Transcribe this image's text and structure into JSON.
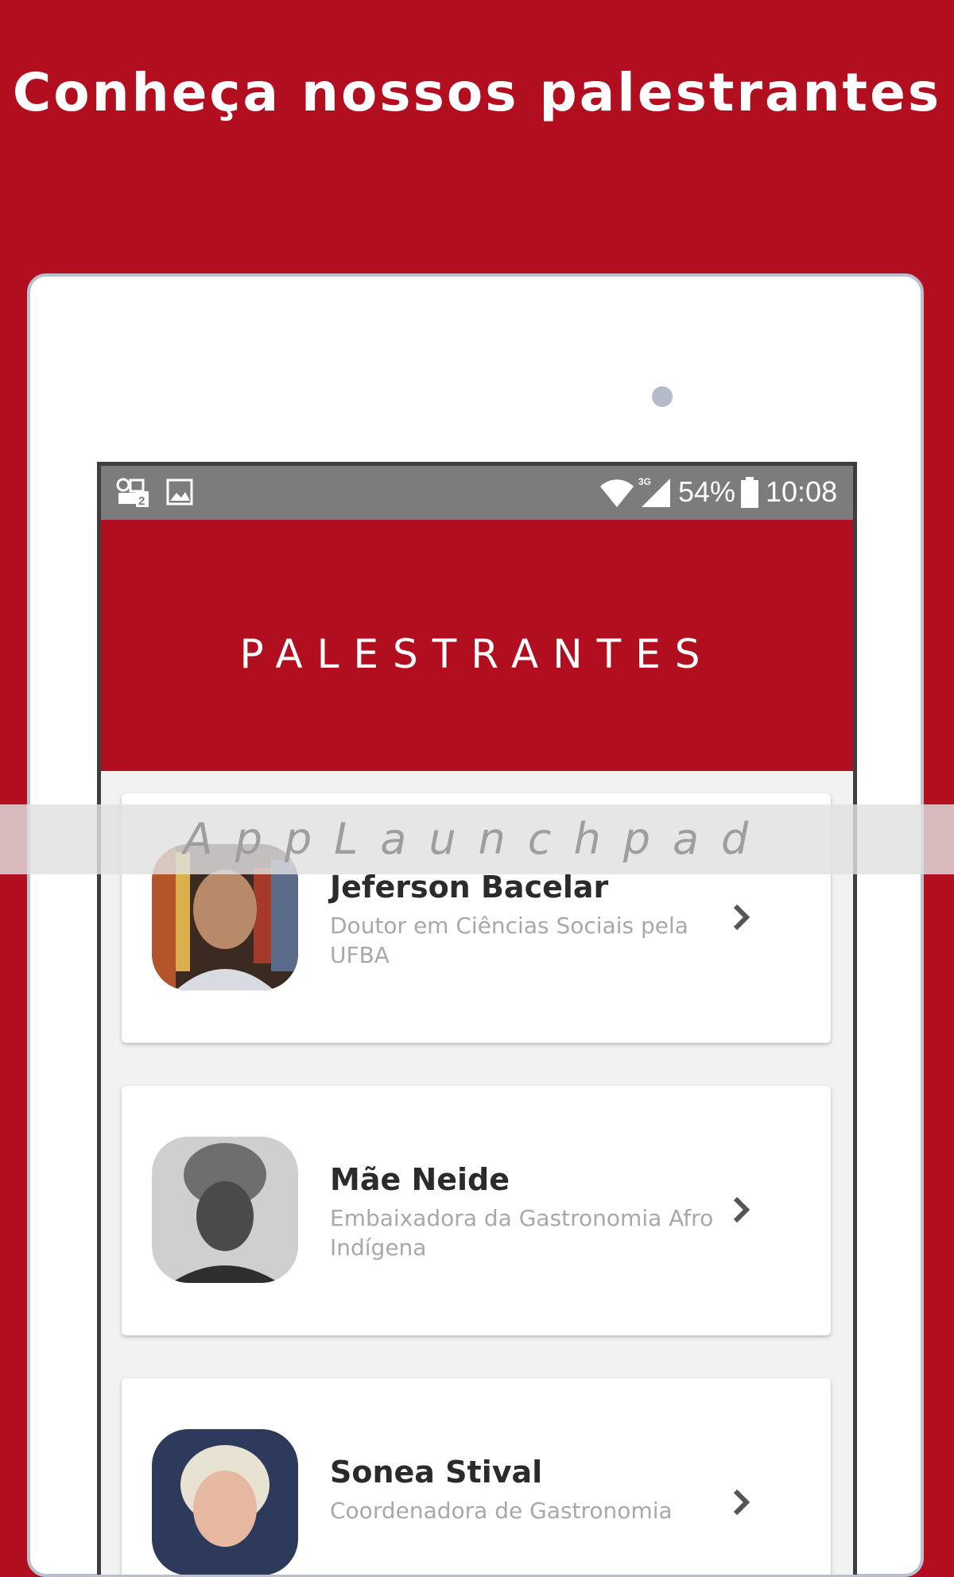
{
  "promo": {
    "title": "Conheça nossos palestrantes"
  },
  "status_bar": {
    "left_icons": [
      "sim-card-2-icon",
      "image-icon"
    ],
    "network": "3G",
    "battery": "54%",
    "time": "10:08"
  },
  "app": {
    "header_title": "PALESTRANTES"
  },
  "speakers": [
    {
      "name": "Jeferson Bacelar",
      "description": "Doutor em Ciências Sociais pela UFBA",
      "photo": "speaker-photo-icon"
    },
    {
      "name": "Mãe Neide",
      "description": "Embaixadora da Gastronomia Afro Indígena",
      "photo": "speaker-photo-icon"
    },
    {
      "name": "Sonea Stival",
      "description": "Coordenadora de Gastronomia",
      "photo": "speaker-photo-icon"
    }
  ],
  "watermark": {
    "text": "AppLaunchpad"
  },
  "colors": {
    "brand_red": "#b10f20",
    "status_bar": "#7c7c7c",
    "card_bg": "#ffffff",
    "list_bg": "#f2f2f2"
  }
}
